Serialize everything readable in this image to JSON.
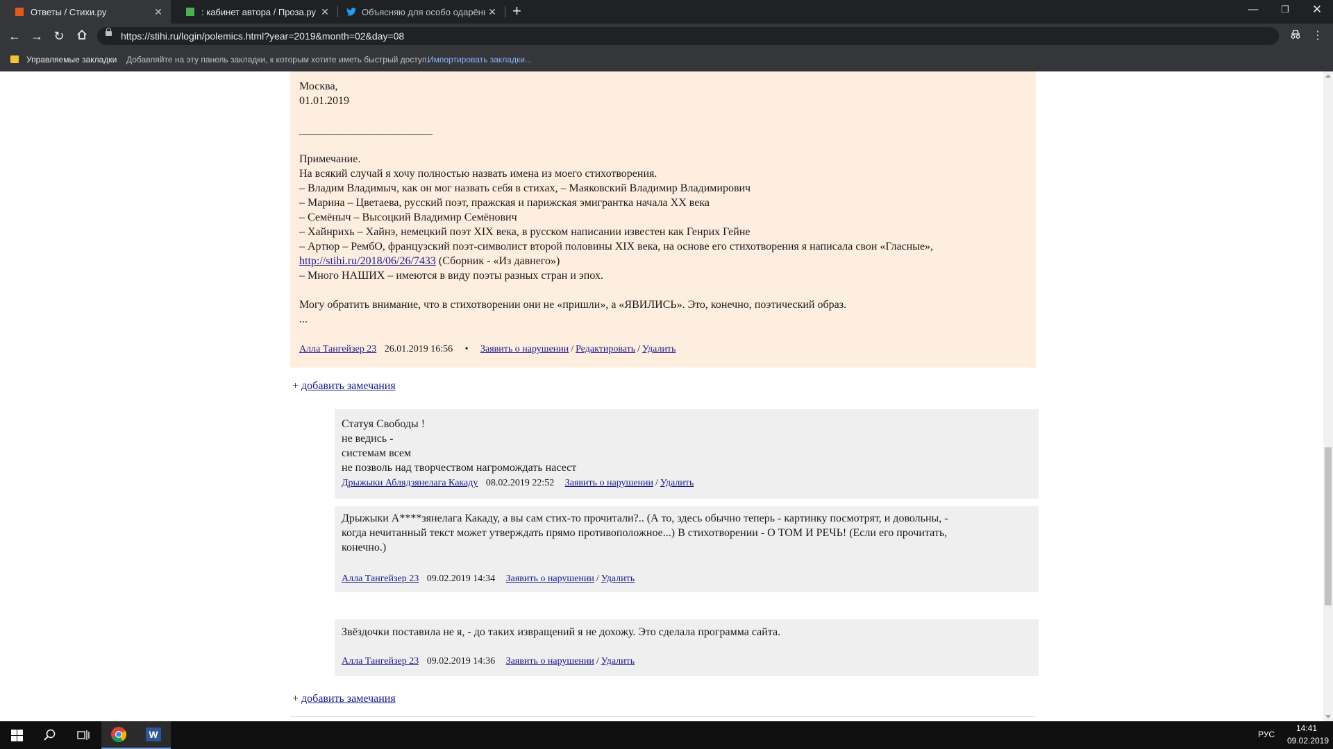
{
  "browser": {
    "tabs": [
      {
        "title": "Ответы / Стихи.ру",
        "active": true,
        "favicon_color": "#e25a1c"
      },
      {
        "title": ": кабинет автора / Проза.ру",
        "active": false,
        "favicon_color": "#4caf50"
      },
      {
        "title": "Объясняю для особо одарённы",
        "active": false,
        "favicon_color": "#1da1f2"
      }
    ],
    "new_tab_label": "+",
    "url": "https://stihi.ru/login/polemics.html?year=2019&month=02&day=08",
    "bookmarks": {
      "managed_label": "Управляемые закладки",
      "hint": "Добавляйте на эту панель закладки, к которым хотите иметь быстрый доступ.",
      "import_link": "Импортировать закладки..."
    }
  },
  "page": {
    "main_review": {
      "lines_top": [
        "Москва,",
        "01.01.2019"
      ],
      "rule": "________________________",
      "note_lines": [
        "Примечание.",
        "На всякий случай я хочу полностью назвать имена из моего стихотворения.",
        "– Владим Владимыч, как он мог назвать себя в стихах, – Маяковский Владимир Владимирович",
        "– Марина – Цветаева, русский поэт, пражская и парижская эмигрантка начала ХХ века",
        "– Семёныч – Высоцкий Владимир Семёнович",
        "– Хайнрихь – Хайнэ, немецкий поэт XIX века, в русском написании известен как Генрих Гейне",
        "– Артюр – РембО, французский поэт-символист второй половины XIX века, на основе его стихотворения я написала свои «Гласные»,"
      ],
      "note_link": "http://stihi.ru/2018/06/26/7433",
      "note_link_suffix": " (Сборник - «Из давнего»)",
      "note_last": "– Много НАШИХ – имеются в виду поэты разных стран и эпох.",
      "closing": "Могу обратить внимание, что в стихотворении они не «пришли», а «ЯВИЛИСЬ». Это, конечно, поэтический образ.",
      "ellipsis": "...",
      "author": "Алла Тангейзер 23",
      "date": "26.01.2019 16:56",
      "bullet": "•",
      "report": "Заявить о нарушении",
      "edit": "Редактировать",
      "delete": "Удалить",
      "sep": "/"
    },
    "add_note_plus": "+",
    "add_note_label": "добавить замечания",
    "replies": [
      {
        "lines": [
          "Статуя Свободы !",
          "не ведись -",
          "системам всем",
          "не позволь над творчеством нагромождать насест"
        ],
        "author": "Дрыжыки Аблядзянелага Какаду",
        "date": "08.02.2019 22:52",
        "report": "Заявить о нарушении",
        "delete": "Удалить"
      },
      {
        "lines": [
          "Дрыжыки А****зянелага Какаду, а вы сам стих-то прочитали?.. (А то, здесь обычно теперь - картинку посмотрят, и довольны, -",
          "когда нечитанный текст может утверждать прямо противоположное...) В стихотворении - О ТОМ И РЕЧЬ! (Если его прочитать,",
          "конечно.)"
        ],
        "author": "Алла Тангейзер 23",
        "date": "09.02.2019 14:34",
        "report": "Заявить о нарушении",
        "delete": "Удалить"
      },
      {
        "lines": [
          "Звёздочки поставила не я, - до таких извращений я не дохожу. Это сделала программа сайта."
        ],
        "author": "Алла Тангейзер 23",
        "date": "09.02.2019 14:36",
        "report": "Заявить о нарушении",
        "delete": "Удалить"
      }
    ]
  },
  "taskbar": {
    "lang": "РУС",
    "time": "14:41",
    "date": "09.02.2019",
    "word_letter": "W"
  }
}
